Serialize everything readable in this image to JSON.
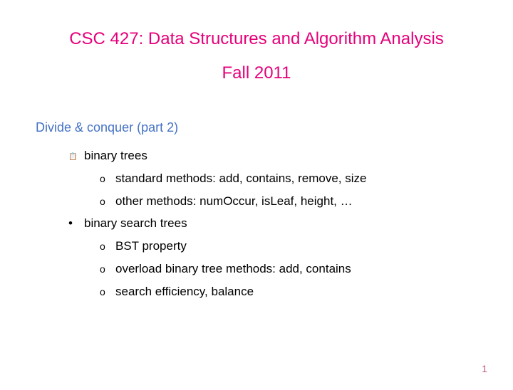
{
  "title_line1": "CSC 427: Data Structures and Algorithm Analysis",
  "title_line2": "Fall 2011",
  "section_header": "Divide & conquer (part 2)",
  "items": {
    "i0": "binary trees",
    "i1": "standard methods: add, contains, remove, size",
    "i2": "other methods: numOccur, isLeaf, height, …",
    "i3": "binary search trees",
    "i4": "BST property",
    "i5": "overload binary tree methods: add, contains",
    "i6": "search efficiency, balance"
  },
  "page_number": "1"
}
